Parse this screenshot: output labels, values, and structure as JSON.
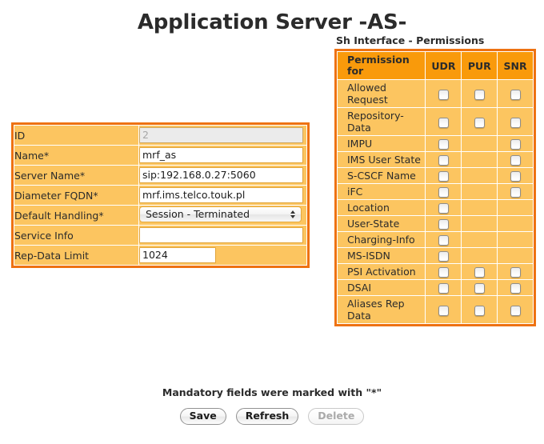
{
  "page": {
    "title": "Application Server -AS-",
    "mandatory_note": "Mandatory fields were marked with \"*\""
  },
  "form": {
    "rows": [
      {
        "label": "ID",
        "type": "text",
        "value": "2",
        "disabled": true,
        "width": "wide"
      },
      {
        "label": "Name*",
        "type": "text",
        "value": "mrf_as",
        "disabled": false,
        "width": "wide"
      },
      {
        "label": "Server Name*",
        "type": "text",
        "value": "sip:192.168.0.27:5060",
        "disabled": false,
        "width": "wide"
      },
      {
        "label": "Diameter FQDN*",
        "type": "text",
        "value": "mrf.ims.telco.touk.pl",
        "disabled": false,
        "width": "wide"
      },
      {
        "label": "Default Handling*",
        "type": "select",
        "value": "Session - Terminated",
        "disabled": false,
        "width": "wide"
      },
      {
        "label": "Service Info",
        "type": "text",
        "value": "",
        "disabled": false,
        "width": "wide"
      },
      {
        "label": "Rep-Data Limit",
        "type": "text",
        "value": "1024",
        "disabled": false,
        "width": "narrow"
      }
    ]
  },
  "permissions": {
    "caption": "Sh Interface - Permissions",
    "columns": [
      "Permission for",
      "UDR",
      "PUR",
      "SNR"
    ],
    "rows": [
      {
        "name": "Allowed Request",
        "udr": true,
        "pur": true,
        "snr": true
      },
      {
        "name": "Repository-Data",
        "udr": true,
        "pur": true,
        "snr": true
      },
      {
        "name": "IMPU",
        "udr": true,
        "pur": false,
        "snr": true
      },
      {
        "name": "IMS User State",
        "udr": true,
        "pur": false,
        "snr": true
      },
      {
        "name": "S-CSCF Name",
        "udr": true,
        "pur": false,
        "snr": true
      },
      {
        "name": "iFC",
        "udr": true,
        "pur": false,
        "snr": true
      },
      {
        "name": "Location",
        "udr": true,
        "pur": false,
        "snr": false
      },
      {
        "name": "User-State",
        "udr": true,
        "pur": false,
        "snr": false
      },
      {
        "name": "Charging-Info",
        "udr": true,
        "pur": false,
        "snr": false
      },
      {
        "name": "MS-ISDN",
        "udr": true,
        "pur": false,
        "snr": false
      },
      {
        "name": "PSI Activation",
        "udr": true,
        "pur": true,
        "snr": true
      },
      {
        "name": "DSAI",
        "udr": true,
        "pur": true,
        "snr": true
      },
      {
        "name": "Aliases Rep Data",
        "udr": true,
        "pur": true,
        "snr": true
      }
    ]
  },
  "buttons": [
    {
      "label": "Save",
      "disabled": false
    },
    {
      "label": "Refresh",
      "disabled": false
    },
    {
      "label": "Delete",
      "disabled": true
    }
  ],
  "colors": {
    "panel_border": "#ee7212",
    "panel_fill": "#fcc560",
    "header_fill": "#f99a0b",
    "text": "#2b2b2b"
  }
}
